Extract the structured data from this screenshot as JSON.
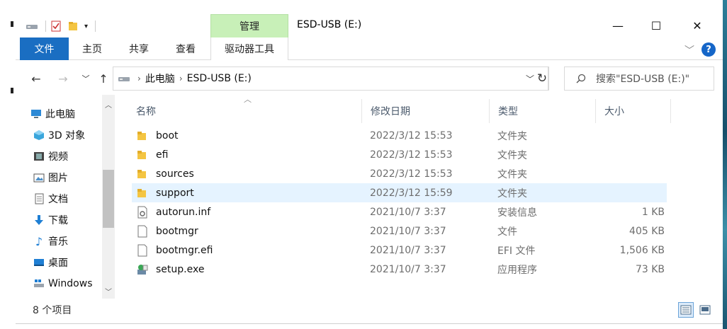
{
  "window": {
    "title": "ESD-USB (E:)",
    "manage_tab": "管理",
    "minimize": "—",
    "maximize": "☐",
    "close": "✕"
  },
  "ribbon": {
    "tabs": [
      "文件",
      "主页",
      "共享",
      "查看",
      "驱动器工具"
    ],
    "collapse": "﹀",
    "help": "?"
  },
  "nav": {
    "back": "←",
    "forward": "→",
    "recent": "﹀",
    "up": "↑",
    "breadcrumb": [
      "此电脑",
      "ESD-USB (E:)"
    ],
    "address_dropdown": "﹀",
    "refresh": "↻",
    "search_placeholder": "搜索\"ESD-USB (E:)\""
  },
  "tree": [
    {
      "label": "此电脑",
      "icon": "computer-icon"
    },
    {
      "label": "3D 对象",
      "icon": "3d-objects-icon"
    },
    {
      "label": "视频",
      "icon": "video-icon"
    },
    {
      "label": "图片",
      "icon": "pictures-icon"
    },
    {
      "label": "文档",
      "icon": "documents-icon"
    },
    {
      "label": "下载",
      "icon": "download-icon"
    },
    {
      "label": "音乐",
      "icon": "music-icon"
    },
    {
      "label": "桌面",
      "icon": "desktop-icon"
    },
    {
      "label": "Windows",
      "icon": "windows-drive-icon"
    }
  ],
  "columns": {
    "name": "名称",
    "modified": "修改日期",
    "type": "类型",
    "size": "大小"
  },
  "files": [
    {
      "name": "boot",
      "modified": "2022/3/12 15:53",
      "type": "文件夹",
      "size": "",
      "icon": "folder-icon"
    },
    {
      "name": "efi",
      "modified": "2022/3/12 15:53",
      "type": "文件夹",
      "size": "",
      "icon": "folder-icon"
    },
    {
      "name": "sources",
      "modified": "2022/3/12 15:53",
      "type": "文件夹",
      "size": "",
      "icon": "folder-icon"
    },
    {
      "name": "support",
      "modified": "2022/3/12 15:59",
      "type": "文件夹",
      "size": "",
      "icon": "folder-icon"
    },
    {
      "name": "autorun.inf",
      "modified": "2021/10/7 3:37",
      "type": "安装信息",
      "size": "1 KB",
      "icon": "setup-info-icon"
    },
    {
      "name": "bootmgr",
      "modified": "2021/10/7 3:37",
      "type": "文件",
      "size": "405 KB",
      "icon": "file-icon"
    },
    {
      "name": "bootmgr.efi",
      "modified": "2021/10/7 3:37",
      "type": "EFI 文件",
      "size": "1,506 KB",
      "icon": "file-icon"
    },
    {
      "name": "setup.exe",
      "modified": "2021/10/7 3:37",
      "type": "应用程序",
      "size": "73 KB",
      "icon": "setup-exe-icon"
    }
  ],
  "status": {
    "item_count": "8 个项目"
  },
  "colors": {
    "accent": "#1a6ec2",
    "manage_tab": "#c8f0b8",
    "hover_row": "#e5f3ff",
    "folder": "#f4c542"
  }
}
